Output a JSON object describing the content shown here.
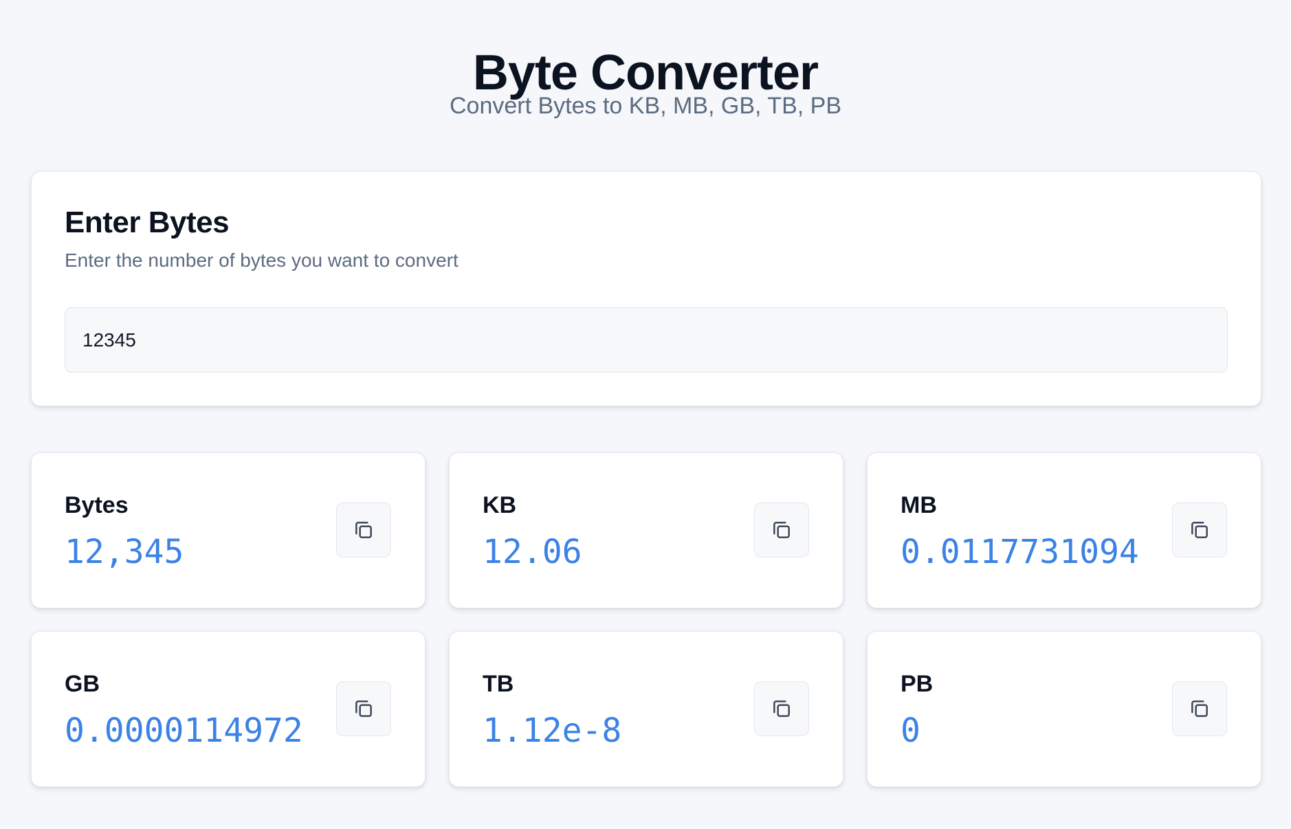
{
  "header": {
    "title": "Byte Converter",
    "subtitle": "Convert Bytes to KB, MB, GB, TB, PB"
  },
  "input_card": {
    "heading": "Enter Bytes",
    "description": "Enter the number of bytes you want to convert",
    "input_value": "12345"
  },
  "results": [
    {
      "label": "Bytes",
      "value": "12,345",
      "icon": "copy-icon"
    },
    {
      "label": "KB",
      "value": "12.06",
      "icon": "copy-icon"
    },
    {
      "label": "MB",
      "value": "0.0117731094",
      "icon": "copy-icon"
    },
    {
      "label": "GB",
      "value": "0.0000114972",
      "icon": "copy-icon"
    },
    {
      "label": "TB",
      "value": "1.12e-8",
      "icon": "copy-icon"
    },
    {
      "label": "PB",
      "value": "0",
      "icon": "copy-icon"
    }
  ],
  "colors": {
    "background": "#f5f7fa",
    "accent": "#3b82e6",
    "text_primary": "#0b1220",
    "text_secondary": "#5b6b80"
  }
}
